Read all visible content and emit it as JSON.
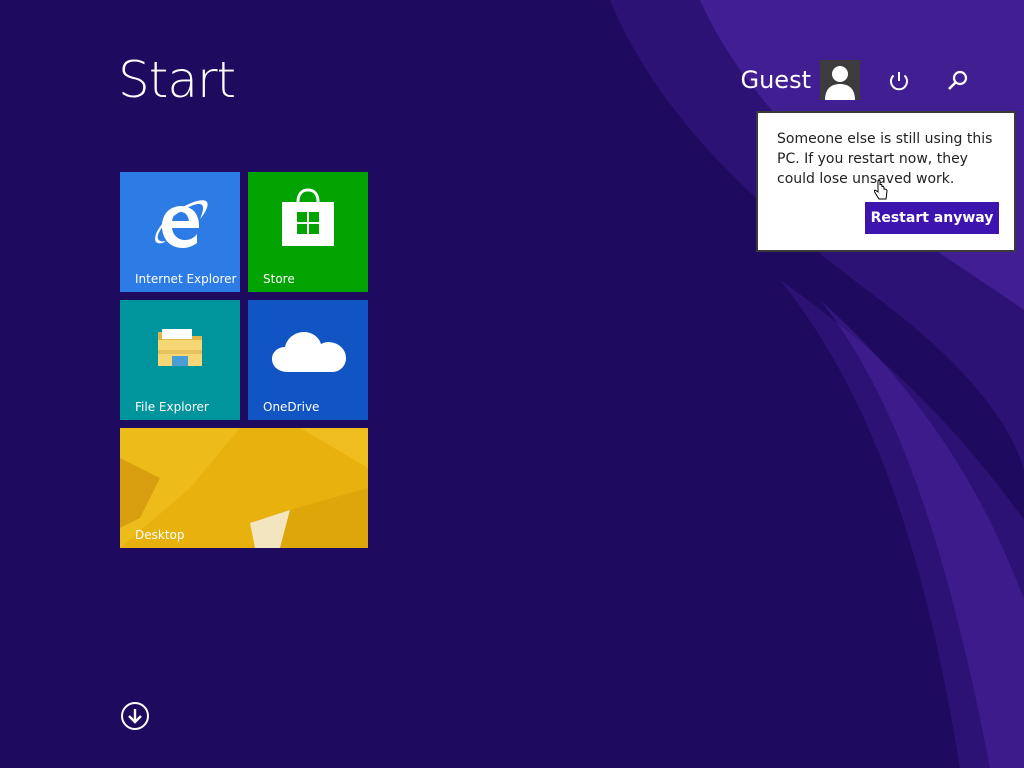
{
  "start": {
    "title": "Start"
  },
  "user": {
    "name": "Guest",
    "avatar_icon": "user-silhouette-icon"
  },
  "header_buttons": {
    "power_icon": "power-icon",
    "search_icon": "search-icon"
  },
  "restart_flyout": {
    "message": "Someone else is still using this PC. If you restart now, they could lose unsaved work.",
    "button_label": "Restart anyway",
    "button_color": "#3d14b0"
  },
  "tiles": [
    {
      "label": "Internet Explorer",
      "icon": "internet-explorer-icon",
      "color": "#2d7be5"
    },
    {
      "label": "Store",
      "icon": "store-icon",
      "color": "#00a300"
    },
    {
      "label": "File Explorer",
      "icon": "file-explorer-icon",
      "color": "#00949c"
    },
    {
      "label": "OneDrive",
      "icon": "onedrive-icon",
      "color": "#1154c4"
    },
    {
      "label": "Desktop",
      "icon": "desktop-wallpaper",
      "color": "#e8b10e"
    }
  ],
  "all_apps": {
    "icon": "down-arrow-circle-icon"
  },
  "theme": {
    "background": "#1e0a5e",
    "accent": "#3d14b0"
  }
}
